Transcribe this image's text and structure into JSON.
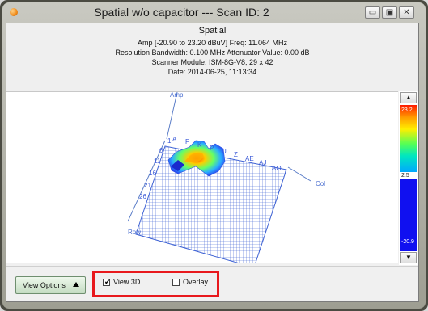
{
  "window": {
    "title": "Spatial w/o capacitor --- Scan ID: 2",
    "buttons": {
      "minimize": "▭",
      "restore": "▣",
      "close": "✕"
    }
  },
  "header": {
    "title": "Spatial",
    "line1": "Amp [-20.90 to 23.20  dBuV]   Freq: 11.064  MHz",
    "line2": "Resolution Bandwidth:  0.100 MHz    Attenuator Value:  0.00 dB",
    "line3": "Scanner Module: ISM-8G-V8,  29 x 42",
    "line4": "Date: 2014-06-25,  11:13:34"
  },
  "plot": {
    "axis_amp": "Amp",
    "axis_col": "Col",
    "axis_row": "Row",
    "col_labels": [
      "A",
      "F",
      "K",
      "P",
      "U",
      "Z",
      "AE",
      "AJ",
      "AO"
    ],
    "row_labels": [
      "1",
      "6",
      "11",
      "16",
      "21",
      "26"
    ]
  },
  "scale": {
    "max": "23.2",
    "mid": "2.5",
    "min": "-20.9",
    "up_arrow": "▲",
    "down_arrow": "▼"
  },
  "bottom": {
    "view_options": "View Options",
    "view3d": {
      "label": "View 3D",
      "checked": true
    },
    "overlay": {
      "label": "Overlay",
      "checked": false
    }
  },
  "colors": {
    "highlight_box": "#e8191d",
    "axis_line": "#5c7ec8",
    "grid_line": "#3e62d4",
    "hot": "#ff2200",
    "low": "#1010f0"
  }
}
